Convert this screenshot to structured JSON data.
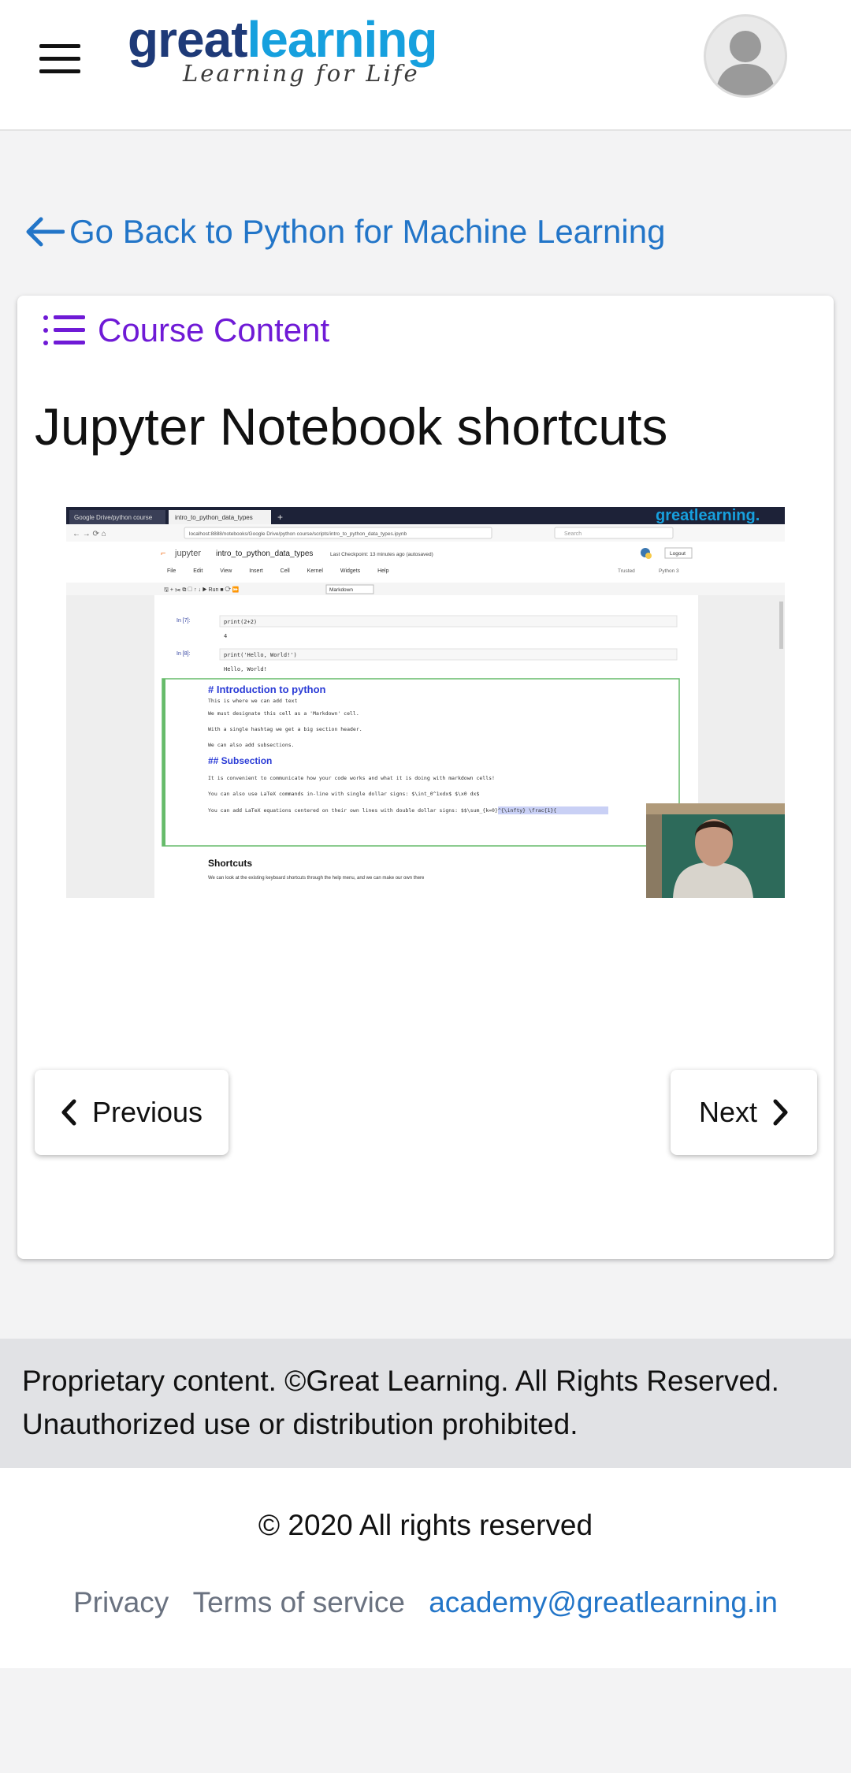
{
  "header": {
    "logo_great": "great",
    "logo_learning": "learning",
    "logo_tagline": "Learning for Life"
  },
  "back_link": "Go Back to Python for Machine Learning",
  "course_content_label": "Course Content",
  "lesson_title": "Jupyter Notebook shortcuts",
  "video": {
    "browser_tab_1": "Google Drive/python course",
    "browser_tab_2": "intro_to_python_data_types",
    "address": "localhost:8888/notebooks/Google Drive/python course/scripts/intro_to_python_data_types.ipynb",
    "search_placeholder": "Search",
    "watermark": "greatlearning.",
    "jupyter_label": "jupyter",
    "notebook_name": "intro_to_python_data_types",
    "checkpoint": "Last Checkpoint: 13 minutes ago  (autosaved)",
    "logout": "Logout",
    "menu": [
      "File",
      "Edit",
      "View",
      "Insert",
      "Cell",
      "Kernel",
      "Widgets",
      "Help"
    ],
    "trusted": "Trusted",
    "kernel": "Python 3",
    "run_label": "Run",
    "cell_type": "Markdown",
    "cell1_prompt": "In [7]:",
    "cell1_code": "print(2+2)",
    "cell1_out": "4",
    "cell2_prompt": "In [8]:",
    "cell2_code": "print('Hello, World!')",
    "cell2_out": "Hello, World!",
    "md_h1": "# Introduction to python",
    "md_lines": [
      "This is where we can add text",
      "We must designate this cell as a 'Markdown' cell.",
      "With a single hashtag we get a big section header.",
      "We can also add subsections."
    ],
    "md_h2": "## Subsection",
    "md_lines2": [
      "It is convenient to communicate how your code works and what it is doing with markdown cells!",
      "You can also use LaTeX commands in-line with single dollar signs:  $\\int_0^1xdx$ $\\x0 dx$",
      "You can add LaTeX equations centered on their own lines with double dollar signs:  $$\\sum_{k=0}^{\\infty} \\frac{1}{"
    ],
    "shortcuts_heading": "Shortcuts",
    "shortcuts_text": "We can look at the existing keyboard shortcuts through the help menu, and we can make our own there"
  },
  "nav": {
    "previous": "Previous",
    "next": "Next"
  },
  "notice": {
    "line1": "Proprietary content. ©Great Learning. All Rights Reserved.",
    "line2": "Unauthorized use or distribution prohibited."
  },
  "footer": {
    "copyright": "© 2020 All rights reserved",
    "privacy": "Privacy",
    "terms": "Terms of service",
    "email": "academy@greatlearning.in"
  },
  "colors": {
    "accent_blue": "#2275c8",
    "course_purple": "#6f1ad6",
    "logo_dark": "#1e3a78",
    "logo_light": "#16a0de"
  }
}
